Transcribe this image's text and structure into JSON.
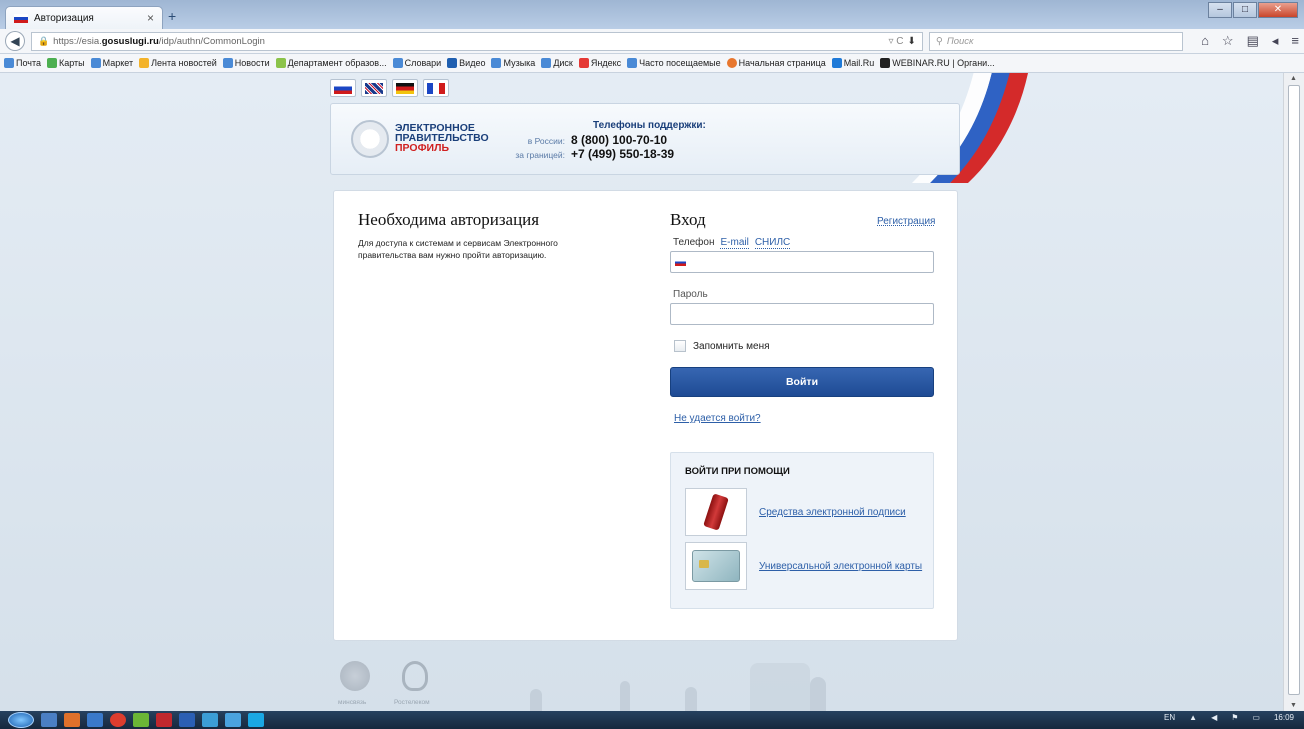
{
  "browser": {
    "tab_title": "Авторизация",
    "tab_close": "×",
    "new_tab": "+",
    "url_prefix": "https://esia.",
    "url_domain": "gosuslugi.ru",
    "url_path": "/idp/authn/CommonLogin",
    "search_placeholder": "Поиск"
  },
  "bookmarks": [
    "Почта",
    "Карты",
    "Маркет",
    "Лента новостей",
    "Новости",
    "Департамент образов...",
    "Словари",
    "Видео",
    "Музыка",
    "Диск",
    "Яндекс",
    "Часто посещаемые",
    "Начальная страница",
    "Mail.Ru",
    "WEBINAR.RU | Органи..."
  ],
  "header": {
    "logo_line1": "ЭЛЕКТРОННОЕ",
    "logo_line2": "ПРАВИТЕЛЬСТВО",
    "logo_line3": "ПРОФИЛЬ",
    "support_title": "Телефоны поддержки:",
    "russia_label": "в России:",
    "russia_phone": "8 (800) 100-70-10",
    "abroad_label": "за границей:",
    "abroad_phone": "+7 (499) 550-18-39"
  },
  "left": {
    "title": "Необходима авторизация",
    "description": "Для доступа к системам и сервисам Электронного правительства вам нужно пройти авторизацию."
  },
  "login": {
    "title": "Вход",
    "register": "Регистрация",
    "tab_phone": "Телефон",
    "tab_email": "E-mail",
    "tab_snils": "СНИЛС",
    "password_label": "Пароль",
    "remember": "Запомнить меня",
    "submit": "Войти",
    "help": "Не удается войти?"
  },
  "alt_login": {
    "title": "ВОЙТИ ПРИ ПОМОЩИ",
    "options": [
      "Средства электронной подписи",
      "Универсальной электронной карты"
    ]
  },
  "footer": {
    "label1": "минсвязь",
    "label2": "Ростелеком"
  },
  "taskbar": {
    "lang": "EN",
    "time": "16:09"
  }
}
